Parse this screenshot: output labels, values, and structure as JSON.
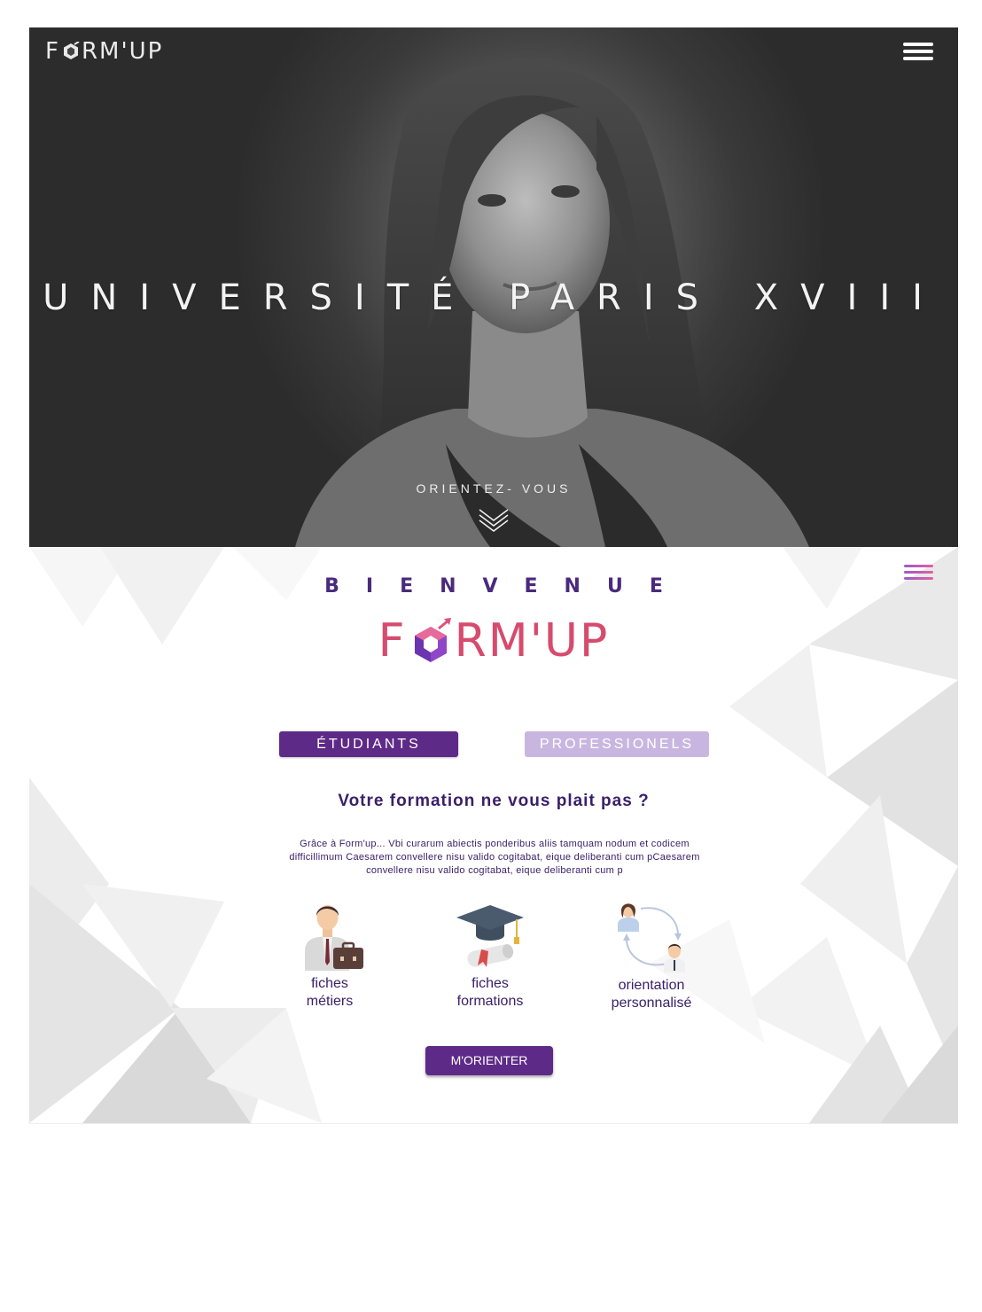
{
  "header": {
    "logo_text_before": "F",
    "logo_text_after": "RM'UP",
    "menu_icon": "hamburger-menu-icon"
  },
  "hero": {
    "title": "UNIVERSITÉ PARIS XVIII",
    "cta": "ORIENTEZ- VOUS",
    "scroll_icon": "double-chevron-down-icon"
  },
  "welcome": {
    "heading": "BIENVENUE",
    "brand_before": "F",
    "brand_after": "RM'UP",
    "tabs": [
      {
        "label": "ÉTUDIANTS",
        "active": true
      },
      {
        "label": "PROFESSIONELS",
        "active": false
      }
    ],
    "question": "Votre formation ne vous plait pas ?",
    "description": "Grâce à Form'up... Vbi curarum abiectis ponderibus aliis tamquam nodum et codicem difficillimum Caesarem convellere nisu valido cogitabat, eique deliberanti cum pCaesarem convellere nisu valido cogitabat, eique deliberanti cum p",
    "features": [
      {
        "line1": "fiches",
        "line2": "métiers",
        "icon": "businessman-briefcase-icon"
      },
      {
        "line1": "fiches",
        "line2": "formations",
        "icon": "graduation-cap-diploma-icon"
      },
      {
        "line1": "orientation",
        "line2": "personnalisé",
        "icon": "people-exchange-icon"
      }
    ],
    "button": "M'ORIENTER"
  },
  "colors": {
    "primary_purple": "#5e2a87",
    "light_purple": "#c9b6e0",
    "brand_pink": "#d64b6e",
    "dark_text": "#3a2069"
  }
}
